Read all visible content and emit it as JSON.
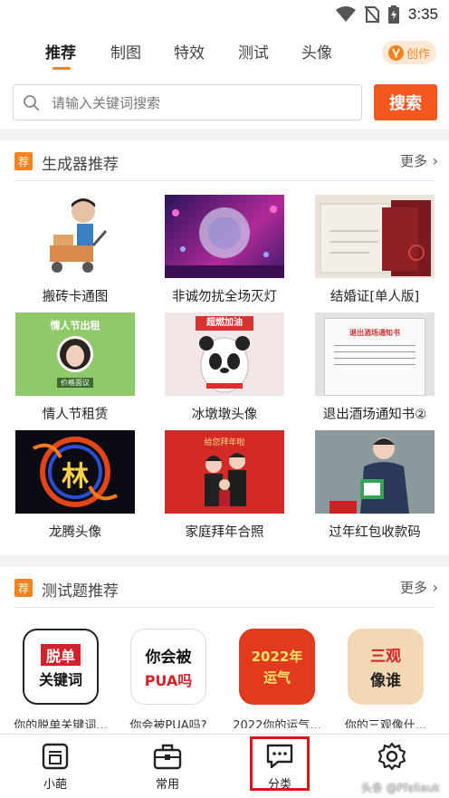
{
  "status": {
    "time": "3:35"
  },
  "tabs": [
    {
      "label": "推荐",
      "active": true
    },
    {
      "label": "制图"
    },
    {
      "label": "特效"
    },
    {
      "label": "测试"
    },
    {
      "label": "头像"
    }
  ],
  "create": {
    "label": "创作"
  },
  "search": {
    "placeholder": "请输入关键词搜索",
    "value": "",
    "button": "搜索"
  },
  "section_generators": {
    "badge": "荐",
    "title": "生成器推荐",
    "more": "更多",
    "items": [
      {
        "label": "搬砖卡通图"
      },
      {
        "label": "非诚勿扰全场灭灯"
      },
      {
        "label": "结婚证[单人版]"
      },
      {
        "label": "情人节租赁",
        "thumb_text_top": "情人节出租",
        "thumb_text_bottom": "价格面议"
      },
      {
        "label": "冰墩墩头像",
        "thumb_text": "超燃加油"
      },
      {
        "label": "退出酒场通知书②",
        "thumb_text": "退出酒场通知书"
      },
      {
        "label": "龙腾头像",
        "thumb_text": "林"
      },
      {
        "label": "家庭拜年合照",
        "thumb_text": "给您拜年啦"
      },
      {
        "label": "过年红包收款码"
      }
    ]
  },
  "section_quiz": {
    "badge": "荐",
    "title": "测试题推荐",
    "more": "更多",
    "items": [
      {
        "label": "你的脱单关键词...",
        "thumb_line1": "脱单",
        "thumb_line2": "关键词"
      },
      {
        "label": "你会被PUA吗?",
        "thumb_line1": "你会被",
        "thumb_line2": "PUA吗"
      },
      {
        "label": "2022你的运气...",
        "thumb_line1": "2022年",
        "thumb_line2": "运气"
      },
      {
        "label": "你的三观像什...",
        "thumb_line1": "三观",
        "thumb_line2": "像谁"
      }
    ]
  },
  "bottom_nav": [
    {
      "label": "小葩",
      "icon": "pa-char-icon"
    },
    {
      "label": "常用",
      "icon": "toolbox-icon"
    },
    {
      "label": "分类",
      "icon": "chat-bubble-icon",
      "highlighted": true
    },
    {
      "label": "",
      "icon": "gear-icon"
    }
  ],
  "watermark": "头条 @Pfeliauk",
  "colors": {
    "accent": "#f5821f",
    "search_button": "#f5571f",
    "highlight_box": "#d9141b"
  }
}
